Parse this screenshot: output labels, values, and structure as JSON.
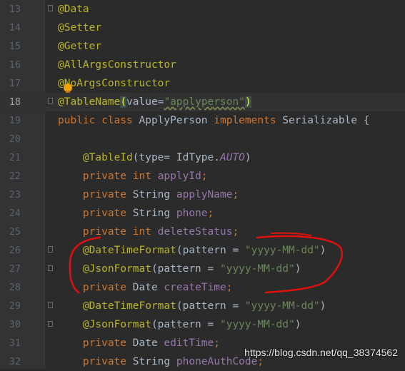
{
  "editor": {
    "lines": [
      {
        "num": "13",
        "tokens": [
          {
            "t": "ann",
            "v": "@Data"
          }
        ]
      },
      {
        "num": "14",
        "tokens": [
          {
            "t": "ann",
            "v": "@Setter"
          }
        ]
      },
      {
        "num": "15",
        "tokens": [
          {
            "t": "ann",
            "v": "@Getter"
          }
        ]
      },
      {
        "num": "16",
        "tokens": [
          {
            "t": "ann",
            "v": "@AllArgsConstructor"
          }
        ]
      },
      {
        "num": "17",
        "tokens": [
          {
            "t": "ann",
            "v": "@NoArgsConstructor"
          }
        ]
      },
      {
        "num": "18",
        "current": true,
        "tokens": [
          {
            "t": "ann",
            "v": "@TableName"
          },
          {
            "t": "paren-hl",
            "v": "("
          },
          {
            "t": "plain",
            "v": "value="
          },
          {
            "t": "str squig",
            "v": "\"applyperson\""
          },
          {
            "t": "paren-hl",
            "v": ")"
          }
        ]
      },
      {
        "num": "19",
        "tokens": [
          {
            "t": "kw",
            "v": "public class "
          },
          {
            "t": "plain",
            "v": "ApplyPerson "
          },
          {
            "t": "kw",
            "v": "implements "
          },
          {
            "t": "plain",
            "v": "Serializable {"
          }
        ]
      },
      {
        "num": "20",
        "tokens": []
      },
      {
        "num": "21",
        "tokens": [
          {
            "t": "plain",
            "v": "    "
          },
          {
            "t": "ann",
            "v": "@TableId"
          },
          {
            "t": "plain",
            "v": "(type= IdType."
          },
          {
            "t": "const",
            "v": "AUTO"
          },
          {
            "t": "plain",
            "v": ")"
          }
        ]
      },
      {
        "num": "22",
        "tokens": [
          {
            "t": "plain",
            "v": "    "
          },
          {
            "t": "kw",
            "v": "private int "
          },
          {
            "t": "fld",
            "v": "applyId"
          },
          {
            "t": "kw",
            "v": ";"
          }
        ]
      },
      {
        "num": "23",
        "tokens": [
          {
            "t": "plain",
            "v": "    "
          },
          {
            "t": "kw",
            "v": "private "
          },
          {
            "t": "plain",
            "v": "String "
          },
          {
            "t": "fld",
            "v": "applyName"
          },
          {
            "t": "kw",
            "v": ";"
          }
        ]
      },
      {
        "num": "24",
        "tokens": [
          {
            "t": "plain",
            "v": "    "
          },
          {
            "t": "kw",
            "v": "private "
          },
          {
            "t": "plain",
            "v": "String "
          },
          {
            "t": "fld",
            "v": "phone"
          },
          {
            "t": "kw",
            "v": ";"
          }
        ]
      },
      {
        "num": "25",
        "tokens": [
          {
            "t": "plain",
            "v": "    "
          },
          {
            "t": "kw",
            "v": "private int "
          },
          {
            "t": "fld",
            "v": "deleteStatus"
          },
          {
            "t": "kw",
            "v": ";"
          }
        ]
      },
      {
        "num": "26",
        "fold": "top",
        "tokens": [
          {
            "t": "plain",
            "v": "    "
          },
          {
            "t": "ann",
            "v": "@DateTimeFormat"
          },
          {
            "t": "plain",
            "v": "(pattern = "
          },
          {
            "t": "str",
            "v": "\"yyyy-MM-dd\""
          },
          {
            "t": "plain",
            "v": ")"
          }
        ]
      },
      {
        "num": "27",
        "fold": "bottom",
        "tokens": [
          {
            "t": "plain",
            "v": "    "
          },
          {
            "t": "ann",
            "v": "@JsonFormat"
          },
          {
            "t": "plain",
            "v": "(pattern = "
          },
          {
            "t": "str",
            "v": "\"yyyy-MM-dd\""
          },
          {
            "t": "plain",
            "v": ")"
          }
        ]
      },
      {
        "num": "28",
        "tokens": [
          {
            "t": "plain",
            "v": "    "
          },
          {
            "t": "kw",
            "v": "private "
          },
          {
            "t": "plain",
            "v": "Date "
          },
          {
            "t": "fld",
            "v": "createTime"
          },
          {
            "t": "kw",
            "v": ";"
          }
        ]
      },
      {
        "num": "29",
        "fold": "top",
        "tokens": [
          {
            "t": "plain",
            "v": "    "
          },
          {
            "t": "ann",
            "v": "@DateTimeFormat"
          },
          {
            "t": "plain",
            "v": "(pattern = "
          },
          {
            "t": "str",
            "v": "\"yyyy-MM-dd\""
          },
          {
            "t": "plain",
            "v": ")"
          }
        ]
      },
      {
        "num": "30",
        "fold": "bottom",
        "tokens": [
          {
            "t": "plain",
            "v": "    "
          },
          {
            "t": "ann",
            "v": "@JsonFormat"
          },
          {
            "t": "plain",
            "v": "(pattern = "
          },
          {
            "t": "str",
            "v": "\"yyyy-MM-dd\""
          },
          {
            "t": "plain",
            "v": ")"
          }
        ]
      },
      {
        "num": "31",
        "tokens": [
          {
            "t": "plain",
            "v": "    "
          },
          {
            "t": "kw",
            "v": "private "
          },
          {
            "t": "plain",
            "v": "Date "
          },
          {
            "t": "fld",
            "v": "editTime"
          },
          {
            "t": "kw",
            "v": ";"
          }
        ]
      },
      {
        "num": "32",
        "tokens": [
          {
            "t": "plain",
            "v": "    "
          },
          {
            "t": "kw",
            "v": "private "
          },
          {
            "t": "plain",
            "v": "String "
          },
          {
            "t": "fld",
            "v": "phoneAuthCode"
          },
          {
            "t": "kw",
            "v": ";"
          }
        ]
      }
    ]
  },
  "icons": {
    "intention_bulb": "lightbulb-icon",
    "fold_marker": "fold-marker-icon"
  },
  "watermark": "https://blog.csdn.net/qq_38374562",
  "colors": {
    "background": "#2b2b2b",
    "annotation": "#bbb529",
    "keyword": "#cc7832",
    "field": "#9876aa",
    "string": "#6a8759",
    "text": "#a9b7c6",
    "scribble": "#e01010"
  }
}
